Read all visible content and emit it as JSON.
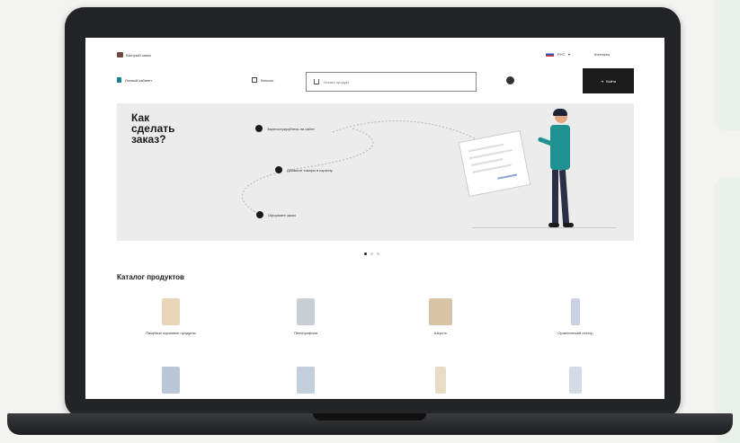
{
  "site": {
    "logo_text": "Быстрый заказ",
    "language": "РУС",
    "contacts": "Контакты"
  },
  "nav": {
    "account": "Личный кабинет",
    "catalog": "Каталог",
    "search_placeholder": "Искать продукт",
    "login": "Войти"
  },
  "banner": {
    "title": "Как сделать заказ?",
    "steps": [
      "Зарегистрируйтесь на сайте",
      "Добавьте товары в корзину",
      "Оформите заказ"
    ],
    "slides": 3,
    "active_slide": 1
  },
  "catalog": {
    "title": "Каталог продуктов",
    "products": [
      {
        "label": "Пищевые кормовые продукты",
        "color": "#e9d6b8"
      },
      {
        "label": "Пенопрофили",
        "color": "#c9ced6"
      },
      {
        "label": "Шерсть",
        "color": "#d8c3a4"
      },
      {
        "label": "Органический сектор",
        "color": "#c7d3e2"
      },
      {
        "label": "",
        "color": "#b9c7d6"
      },
      {
        "label": "",
        "color": "#c3cfdb"
      },
      {
        "label": "",
        "color": "#e8dcc4"
      },
      {
        "label": "",
        "color": "#d3dbe6"
      }
    ]
  },
  "colors": {
    "accent": "#1f9191",
    "button": "#1b1b1b",
    "banner_bg": "#ececec"
  }
}
